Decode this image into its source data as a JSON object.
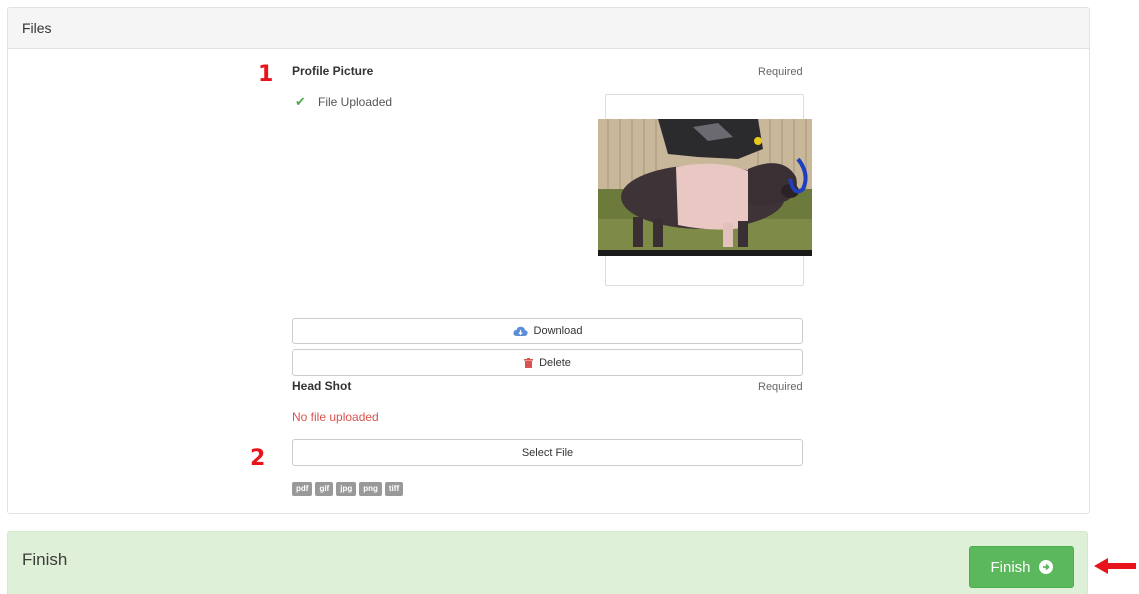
{
  "files_panel": {
    "title": "Files",
    "profile_picture": {
      "marker": "1",
      "label": "Profile Picture",
      "required": "Required",
      "status": "File Uploaded",
      "download_label": "Download",
      "delete_label": "Delete"
    },
    "head_shot": {
      "marker": "2",
      "label": "Head Shot",
      "required": "Required",
      "status": "No file uploaded",
      "select_label": "Select File",
      "file_types": [
        "pdf",
        "gif",
        "jpg",
        "png",
        "tiff"
      ]
    }
  },
  "finish_panel": {
    "title": "Finish",
    "button_label": "Finish"
  },
  "colors": {
    "success": "#5cb85c",
    "danger": "#d9534f",
    "marker_red": "#e8141c",
    "finish_bg": "#dff0d8"
  },
  "icons": [
    "check-icon",
    "cloud-download-icon",
    "trash-icon",
    "arrow-circle-right-icon",
    "red-arrow-icon"
  ]
}
